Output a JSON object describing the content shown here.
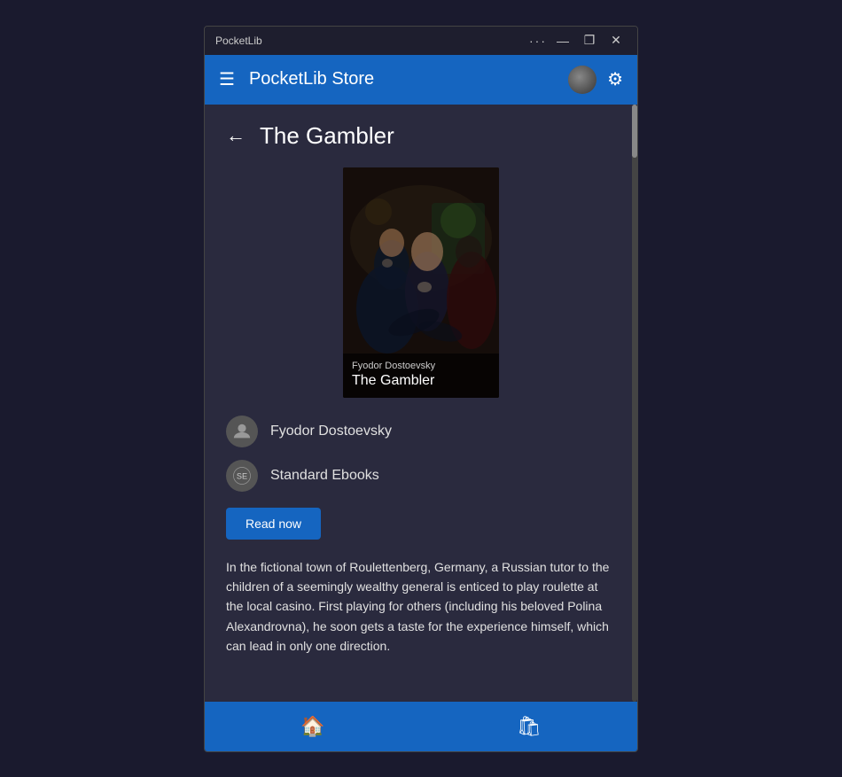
{
  "window": {
    "app_name": "PocketLib",
    "title_dots": "···",
    "minimize": "—",
    "maximize": "❐",
    "close": "✕"
  },
  "header": {
    "title": "PocketLib Store",
    "hamburger": "☰",
    "gear": "⚙"
  },
  "page": {
    "back_arrow": "←",
    "title": "The Gambler"
  },
  "book": {
    "author": "Fyodor Dostoevsky",
    "title": "The Gambler",
    "publisher": "Standard Ebooks",
    "cover_author": "Fyodor Dostoevsky",
    "cover_title": "The Gambler",
    "description": "In the fictional town of Roulettenberg, Germany, a Russian tutor to the children of a seemingly wealthy general is enticed to play roulette at the local casino. First playing for others (including his beloved Polina Alexandrovna), he soon gets a taste for the experience himself, which can lead in only one direction."
  },
  "buttons": {
    "read_now": "Read now"
  },
  "nav": {
    "home_icon": "🏠",
    "bag_icon": "🛍"
  }
}
